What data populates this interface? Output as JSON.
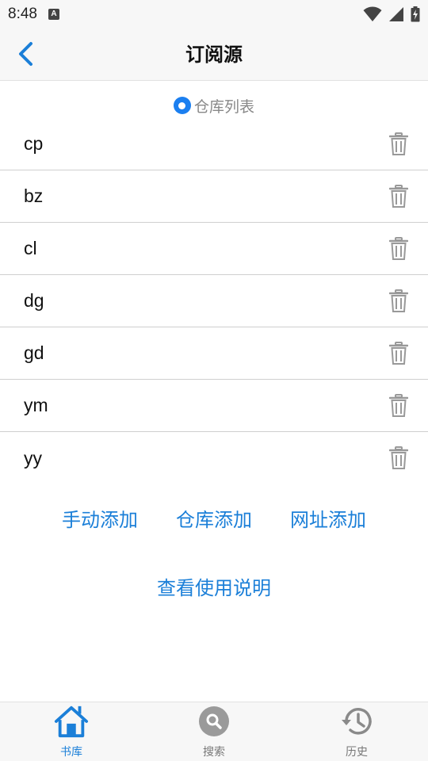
{
  "status_bar": {
    "time": "8:48",
    "badge": "A",
    "icons": [
      "wifi-icon",
      "signal-icon",
      "battery-icon"
    ]
  },
  "header": {
    "title": "订阅源",
    "back_icon": "chevron-left-icon"
  },
  "repo_toggle": {
    "label": "仓库列表",
    "selected": true
  },
  "sources": [
    {
      "name": "cp"
    },
    {
      "name": "bz"
    },
    {
      "name": "cl"
    },
    {
      "name": "dg"
    },
    {
      "name": "gd"
    },
    {
      "name": "ym"
    },
    {
      "name": "yy"
    }
  ],
  "actions": {
    "manual_add": "手动添加",
    "repo_add": "仓库添加",
    "url_add": "网址添加",
    "help": "查看使用说明"
  },
  "bottom_nav": {
    "items": [
      {
        "label": "书库",
        "icon": "home-icon",
        "active": true
      },
      {
        "label": "搜索",
        "icon": "search-icon",
        "active": false
      },
      {
        "label": "历史",
        "icon": "history-icon",
        "active": false
      }
    ]
  },
  "colors": {
    "accent": "#1b7fd8",
    "radio": "#1b7ff0",
    "muted_icon": "#999999",
    "bar_bg": "#f7f7f7"
  }
}
